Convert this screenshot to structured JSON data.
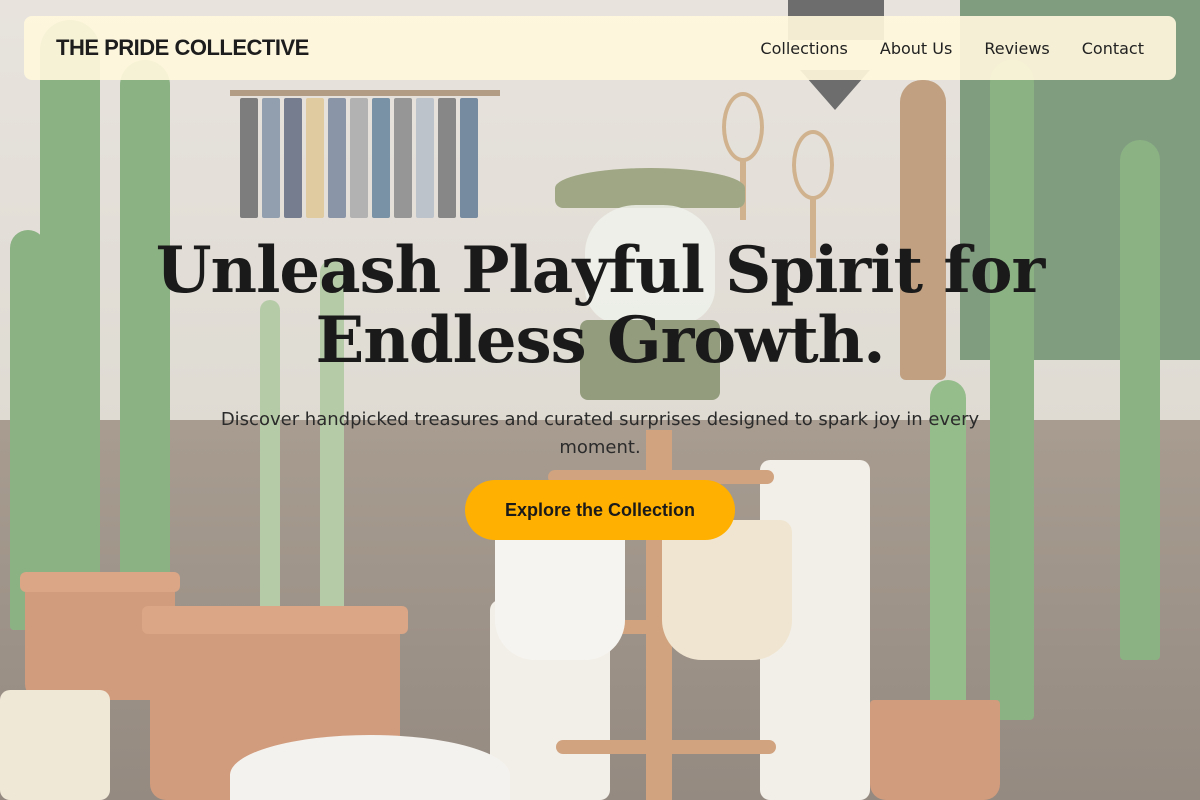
{
  "nav": {
    "brand": "THE PRIDE COLLECTIVE",
    "links": [
      "Collections",
      "About Us",
      "Reviews",
      "Contact"
    ]
  },
  "hero": {
    "title_line1": "Unleash Playful Spirit for",
    "title_line2": "Endless Growth.",
    "subtitle": "Discover handpicked treasures and curated surprises designed to spark joy in every moment.",
    "cta_label": "Explore the Collection"
  },
  "colors": {
    "accent": "#ffb000",
    "nav_bg": "#fff7dc",
    "text": "#1a1a1a"
  }
}
